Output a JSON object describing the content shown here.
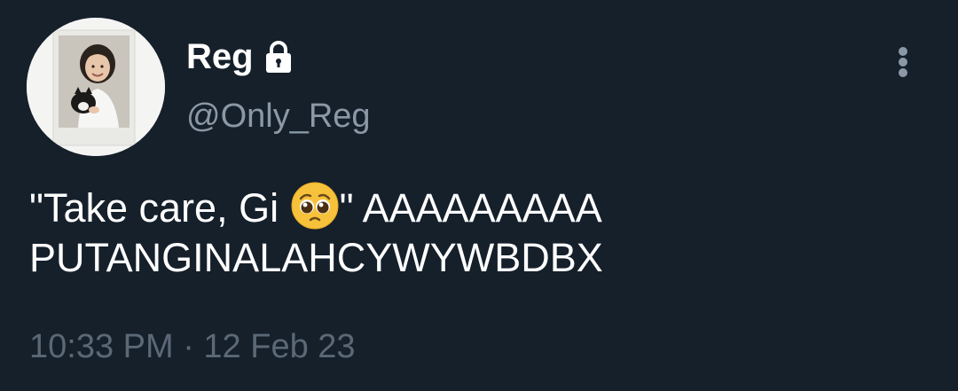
{
  "author": {
    "display_name": "Reg",
    "handle": "@Only_Reg",
    "protected": true
  },
  "tweet": {
    "line1_pre": "\"Take care, Gi ",
    "emoji": "pleading-face",
    "line1_post": "\" AAAAAAAAA",
    "line2": "PUTANGINALAHCYWYWBDBX"
  },
  "meta": {
    "timestamp": "10:33 PM · 12 Feb 23"
  },
  "colors": {
    "background": "#15202b",
    "text": "#ffffff",
    "secondary": "#8b98a5",
    "muted": "#5b6875"
  },
  "icons": {
    "lock": "lock-icon",
    "more": "more-vertical-icon"
  }
}
